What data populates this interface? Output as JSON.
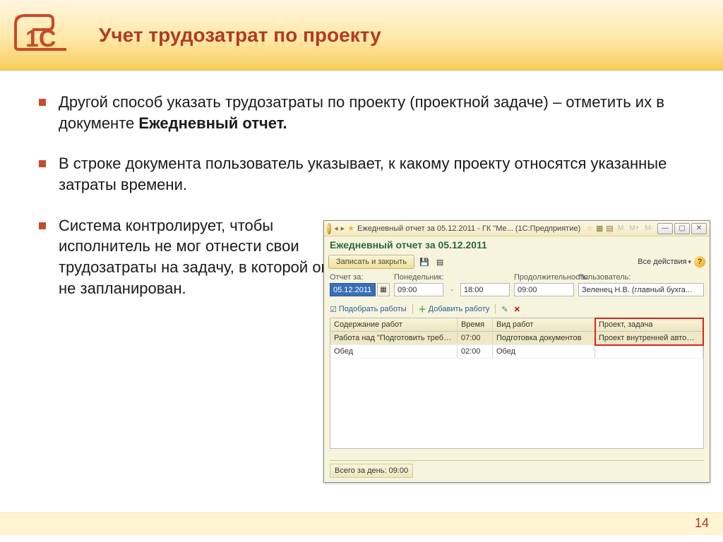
{
  "slide": {
    "title": "Учет трудозатрат по проекту",
    "page_number": "14",
    "bullets": [
      {
        "prefix": "Другой способ указать трудозатраты по проекту (проектной задаче) – отметить их в документе ",
        "bold": "Ежедневный отчет."
      },
      {
        "text": "В строке документа пользователь указывает, к какому проекту относятся указанные затраты времени."
      },
      {
        "text": "Система контролирует, чтобы исполнитель не мог отнести свои трудозатраты на задачу, в которой он не запланирован."
      }
    ]
  },
  "app": {
    "titlebar": {
      "text": "Ежедневный отчет за 05.12.2011 - ГК \"Ме...   (1С:Предприятие)",
      "window_buttons": [
        "—",
        "▢",
        "✕"
      ],
      "tb_extra": [
        "M",
        "M+",
        "M-"
      ]
    },
    "doc_title": "Ежедневный отчет за 05.12.2011",
    "toolbar": {
      "main_button": "Записать и закрыть",
      "all_actions": "Все действия"
    },
    "fields": {
      "labels": {
        "date": "Отчет за:",
        "weekday": "Понедельник:",
        "duration": "Продолжительность:",
        "user": "Пользователь:"
      },
      "date": "05.12.2011",
      "from": "09:00",
      "to": "18:00",
      "duration": "09:00",
      "user": "Зеленец Н.В. (главный бухга..."
    },
    "sub_toolbar": {
      "pick": "Подобрать работы",
      "add": "Добавить работу"
    },
    "grid": {
      "headers": [
        "Содержание работ",
        "Время",
        "Вид работ",
        "Проект, задача"
      ],
      "rows": [
        {
          "c0": "Работа над \"Подготовить требования к ...",
          "c1": "07:00",
          "c2": "Подготовка документов",
          "c3": "Проект внутренней автомати..."
        },
        {
          "c0": "Обед",
          "c1": "02:00",
          "c2": "Обед",
          "c3": ""
        }
      ]
    },
    "footer": "Всего за день: 09:00"
  }
}
